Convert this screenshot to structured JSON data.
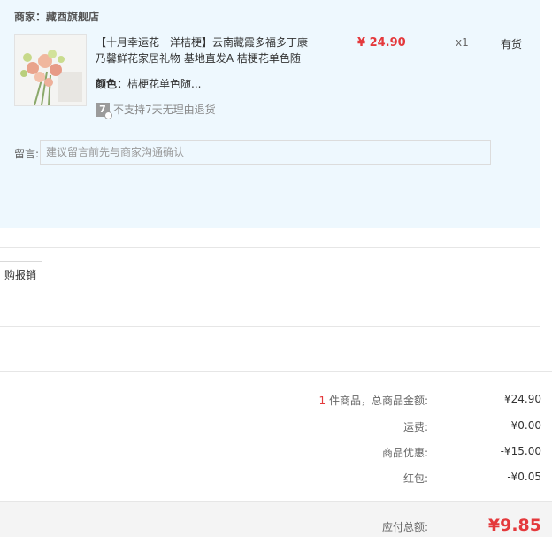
{
  "order": {
    "merchant": "商家：藏酉旗舰店",
    "item": {
      "title": "【十月幸运花一洋桔梗】云南藏霞多福多丁康乃馨鲜花家居礼物 基地直发A 桔梗花单色随",
      "price": "¥ 24.90",
      "qty": "x1",
      "stock": "有货",
      "spec_key": "颜色：",
      "spec_val": "桔梗花单色随...",
      "return_icon": "7",
      "return_text": "不支持7天无理由退货"
    },
    "message": {
      "label": "留言:",
      "placeholder": "建议留言前先与商家沟通确认"
    }
  },
  "reimburse_button": "购报销",
  "summary": {
    "count": "1",
    "count_suffix": " 件商品，总商品金额:",
    "goods_total": "¥24.90",
    "shipping_label": "运费:",
    "shipping": "¥0.00",
    "discount_label": "商品优惠:",
    "discount": "-¥15.00",
    "redpacket_label": "红包:",
    "redpacket": "-¥0.05",
    "payable_label": "应付总额:",
    "payable": "¥9.85"
  },
  "colors": {
    "accent_red": "#e4393c",
    "panel_bg": "#eef8fe"
  }
}
